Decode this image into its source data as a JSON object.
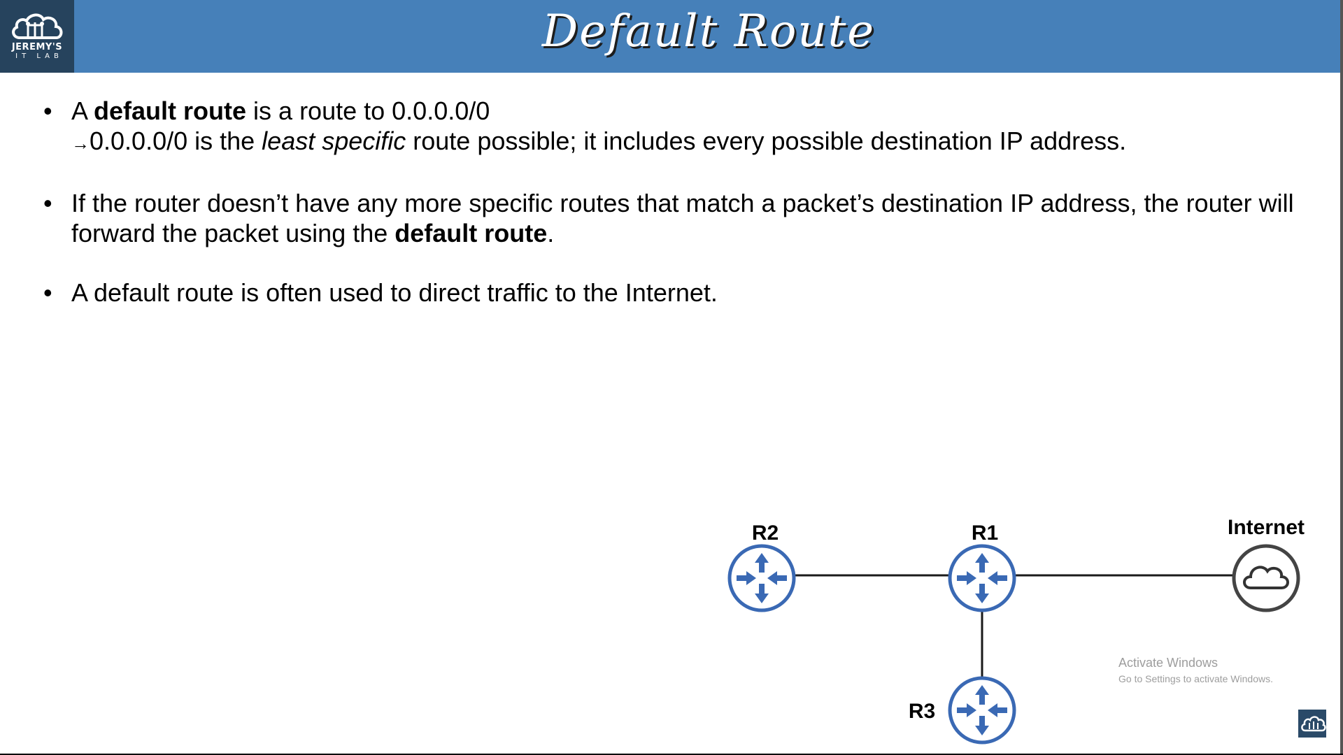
{
  "header": {
    "title": "Default Route",
    "logo_line1": "JEREMY'S",
    "logo_line2": "IT LAB",
    "background_color": "#4680b9",
    "logo_background_color": "#26435d"
  },
  "bullets": [
    {
      "part_a": "A ",
      "bold_1": "default route",
      "part_b": " is a route to 0.0.0.0/0",
      "arrow_symbol": "→",
      "part_c": "0.0.0.0/0 is the ",
      "italic_1": "least specific",
      "part_d": " route possible; it includes every possible destination IP address."
    },
    {
      "part_a": "If the router doesn’t have any more specific routes that match a packet’s destination IP address, the router will forward the packet using the ",
      "bold_1": "default route",
      "part_b": "."
    },
    {
      "text": "A default route is often used to direct traffic to the Internet."
    }
  ],
  "bullet_symbol": "•",
  "diagram": {
    "nodes": {
      "r2": {
        "label": "R2",
        "type": "router-icon"
      },
      "r1": {
        "label": "R1",
        "type": "router-icon"
      },
      "internet": {
        "label": "Internet",
        "type": "cloud-icon"
      },
      "r3": {
        "label": "R3",
        "type": "router-icon"
      }
    },
    "links": [
      {
        "from": "R2",
        "to": "R1"
      },
      {
        "from": "R1",
        "to": "Internet"
      },
      {
        "from": "R1",
        "to": "R3"
      }
    ],
    "router_color": "#3a69b4"
  },
  "watermark": {
    "line1": "Activate Windows",
    "line2": "Go to Settings to activate Windows."
  }
}
